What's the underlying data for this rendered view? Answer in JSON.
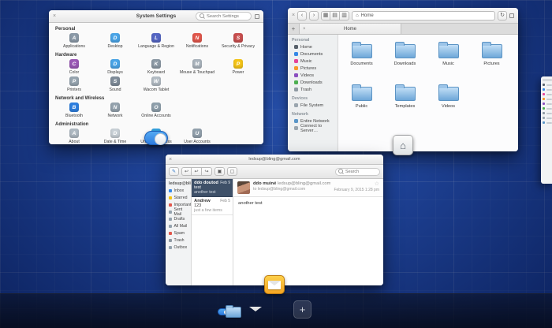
{
  "wallpaper": {
    "base_color": "#1a44a8",
    "accent_selection": "#3689e6"
  },
  "glyphs": {
    "close": "×",
    "back": "‹",
    "forward": "›",
    "view_grid": "▦",
    "view_list": "▤",
    "view_column": "▥",
    "home": "⌂",
    "refresh": "↻",
    "add_tab": "+",
    "tab_close": "×",
    "star": "☆",
    "compose": "✎",
    "reply": "↩",
    "reply_all": "↩",
    "forward_mail": "↪",
    "archive": "▣",
    "trash": "▢",
    "add_workspace": "+"
  },
  "settings": {
    "title": "System Settings",
    "search_placeholder": "Search Settings",
    "sections": [
      {
        "title": "Personal",
        "items": [
          {
            "label": "Applications",
            "icon": "applications-icon",
            "color": "#8b9aa8",
            "glyph": "A"
          },
          {
            "label": "Desktop",
            "icon": "desktop-icon",
            "color": "#4aa5e8",
            "glyph": "D"
          },
          {
            "label": "Language & Region",
            "icon": "language-region-icon",
            "color": "#5566c4",
            "glyph": "L"
          },
          {
            "label": "Notifications",
            "icon": "notifications-icon",
            "color": "#e2574c",
            "glyph": "N"
          },
          {
            "label": "Security & Privacy",
            "icon": "security-privacy-icon",
            "color": "#c94f4f",
            "glyph": "S"
          }
        ]
      },
      {
        "title": "Hardware",
        "items": [
          {
            "label": "Color",
            "icon": "color-icon",
            "color": "#9b59b6",
            "glyph": "C"
          },
          {
            "label": "Displays",
            "icon": "displays-icon",
            "color": "#4aa5e8",
            "glyph": "D"
          },
          {
            "label": "Keyboard",
            "icon": "keyboard-icon",
            "color": "#8d9aa5",
            "glyph": "K"
          },
          {
            "label": "Mouse & Touchpad",
            "icon": "mouse-touchpad-icon",
            "color": "#aab4bd",
            "glyph": "M"
          },
          {
            "label": "Power",
            "icon": "power-icon",
            "color": "#f5c518",
            "glyph": "P"
          },
          {
            "label": "Printers",
            "icon": "printers-icon",
            "color": "#97a5b0",
            "glyph": "P"
          },
          {
            "label": "Sound",
            "icon": "sound-icon",
            "color": "#7f8c99",
            "glyph": "S"
          },
          {
            "label": "Wacom Tablet",
            "icon": "wacom-tablet-icon",
            "color": "#b3bcc4",
            "glyph": "W"
          }
        ]
      },
      {
        "title": "Network and Wireless",
        "items": [
          {
            "label": "Bluetooth",
            "icon": "bluetooth-icon",
            "color": "#2d7fe0",
            "glyph": "B"
          },
          {
            "label": "Network",
            "icon": "network-icon",
            "color": "#95a3ae",
            "glyph": "N"
          },
          {
            "label": "Online Accounts",
            "icon": "online-accounts-icon",
            "color": "#8fa0ac",
            "glyph": "O"
          }
        ]
      },
      {
        "title": "Administration",
        "items": [
          {
            "label": "About",
            "icon": "about-icon",
            "color": "#aeb9c2",
            "glyph": "A"
          },
          {
            "label": "Date & Time",
            "icon": "date-time-icon",
            "color": "#c8d0d6",
            "glyph": "D"
          },
          {
            "label": "Universal Access",
            "icon": "universal-access-icon",
            "color": "#35a3e0",
            "glyph": "U"
          },
          {
            "label": "User Accounts",
            "icon": "user-accounts-icon",
            "color": "#93a1ad",
            "glyph": "U"
          }
        ]
      }
    ]
  },
  "files": {
    "tab_label": "Home",
    "path_label": "Home",
    "sidebar": [
      {
        "title": "Personal",
        "items": [
          {
            "label": "Home",
            "color": "#57606a"
          },
          {
            "label": "Documents",
            "color": "#3689e6"
          },
          {
            "label": "Music",
            "color": "#e6449b"
          },
          {
            "label": "Pictures",
            "color": "#f79a2a"
          },
          {
            "label": "Videos",
            "color": "#8a4ebf"
          },
          {
            "label": "Downloads",
            "color": "#4caf50"
          },
          {
            "label": "Trash",
            "color": "#8f9aa3"
          }
        ]
      },
      {
        "title": "Devices",
        "items": [
          {
            "label": "File System",
            "color": "#9aa5ae"
          }
        ]
      },
      {
        "title": "Network",
        "items": [
          {
            "label": "Entire Network",
            "color": "#5a96c8"
          },
          {
            "label": "Connect to Server…",
            "color": "#9aa5ae"
          }
        ]
      }
    ],
    "folders": [
      "Documents",
      "Downloads",
      "Music",
      "Pictures",
      "Public",
      "Templates",
      "Videos"
    ]
  },
  "mail": {
    "title": "ledsup@bling@gmail.com",
    "account": "ledsup@bling…",
    "search_placeholder": "Search",
    "folders": [
      {
        "label": "Inbox",
        "color": "#3689e6"
      },
      {
        "label": "Starred",
        "color": "#f5c211"
      },
      {
        "label": "Important",
        "color": "#e2574c"
      },
      {
        "label": "Sent Mail",
        "color": "#95a3ae"
      },
      {
        "label": "Drafts",
        "color": "#95a3ae"
      },
      {
        "label": "All Mail",
        "color": "#95a3ae"
      },
      {
        "label": "Spam",
        "color": "#e2574c"
      },
      {
        "label": "Trash",
        "color": "#8f9aa3"
      },
      {
        "label": "Outbox",
        "color": "#95a3ae"
      }
    ],
    "conversations": [
      {
        "sender": "ddo doutod",
        "subject": "test",
        "preview": "another test",
        "date": "Feb 9",
        "selected": true
      },
      {
        "sender": "Andrew",
        "subject": "123",
        "preview": "just a few items",
        "date": "Feb 5",
        "selected": false
      }
    ],
    "message": {
      "from_name": "ddo muiné",
      "from_email": "ledsup@bling@gmail.com",
      "to": "to ledsup@bling@gmail.com",
      "date": "February 9, 2015 1:28 pm",
      "body": "another test"
    }
  }
}
